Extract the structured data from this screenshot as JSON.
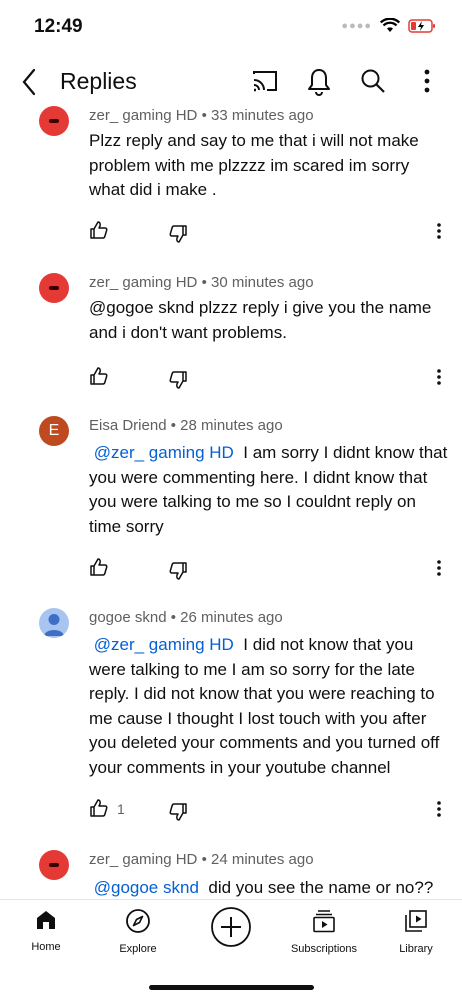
{
  "status_bar": {
    "time": "12:49"
  },
  "header": {
    "title": "Replies"
  },
  "comments": [
    {
      "author": "zer_ gaming HD",
      "time": "• 33 minutes ago",
      "mention": "",
      "text": "Plzz reply and say to me that i will not make problem with me plzzzz im scared im sorry what did i make .",
      "likes": "",
      "avatar_color": "#e53935"
    },
    {
      "author": "zer_ gaming HD",
      "time": "• 30 minutes ago",
      "mention": "",
      "text": "@gogoe sknd plzzz reply i give you the name and i don't want problems.",
      "likes": "",
      "avatar_color": "#e53935"
    },
    {
      "author": "Eisa Driend",
      "time": "• 28 minutes ago",
      "avatar_letter": "E",
      "mention": "@zer_ gaming HD",
      "text": "I am sorry I didnt know that you were commenting here. I didnt know that you were talking to me so I couldnt reply on time sorry",
      "likes": "",
      "avatar_color": "#bf4a1f"
    },
    {
      "author": "gogoe sknd",
      "time": "• 26 minutes ago",
      "mention": "@zer_ gaming HD",
      "text": "I did not know that you were talking to me I am so sorry for the late reply. I did not know that you were reaching to me cause I thought I lost touch with you after you deleted your comments and you turned off your comments in your youtube channel",
      "likes": "1",
      "avatar_color": "#a8c4f0"
    },
    {
      "author": "zer_ gaming HD",
      "time": "• 24 minutes ago",
      "mention": "@gogoe sknd",
      "text": "did you see the name or no??",
      "likes": "",
      "avatar_color": "#e53935"
    }
  ],
  "bottom_nav": [
    {
      "label": "Home",
      "icon": "home-icon"
    },
    {
      "label": "Explore",
      "icon": "compass-icon"
    },
    {
      "label": "",
      "icon": "create-icon"
    },
    {
      "label": "Subscriptions",
      "icon": "subscriptions-icon"
    },
    {
      "label": "Library",
      "icon": "library-icon"
    }
  ]
}
